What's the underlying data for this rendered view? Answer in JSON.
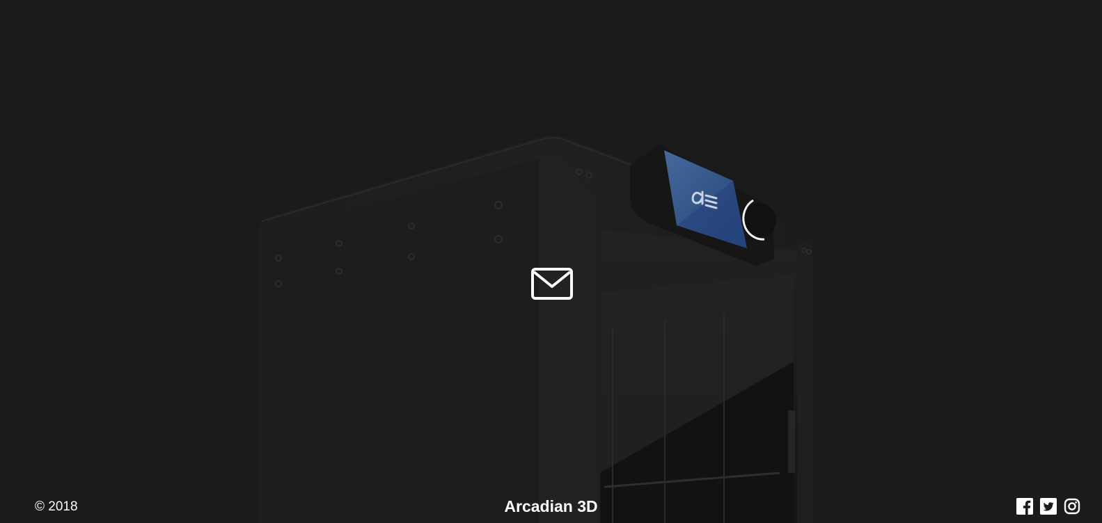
{
  "footer": {
    "copyright": "© 2018",
    "brand": "Arcadian 3D"
  },
  "hero": {
    "contact_icon": "envelope-icon",
    "screen_logo_icon": "arcadian-logo-icon"
  },
  "social": [
    {
      "name": "Facebook",
      "icon": "facebook-icon"
    },
    {
      "name": "Twitter",
      "icon": "twitter-icon"
    },
    {
      "name": "Instagram",
      "icon": "instagram-icon"
    }
  ],
  "colors": {
    "background": "#1b1b1b",
    "printer_body": "#1f1f1f",
    "screen_blue": "#3b5e93",
    "text": "#ffffff"
  }
}
